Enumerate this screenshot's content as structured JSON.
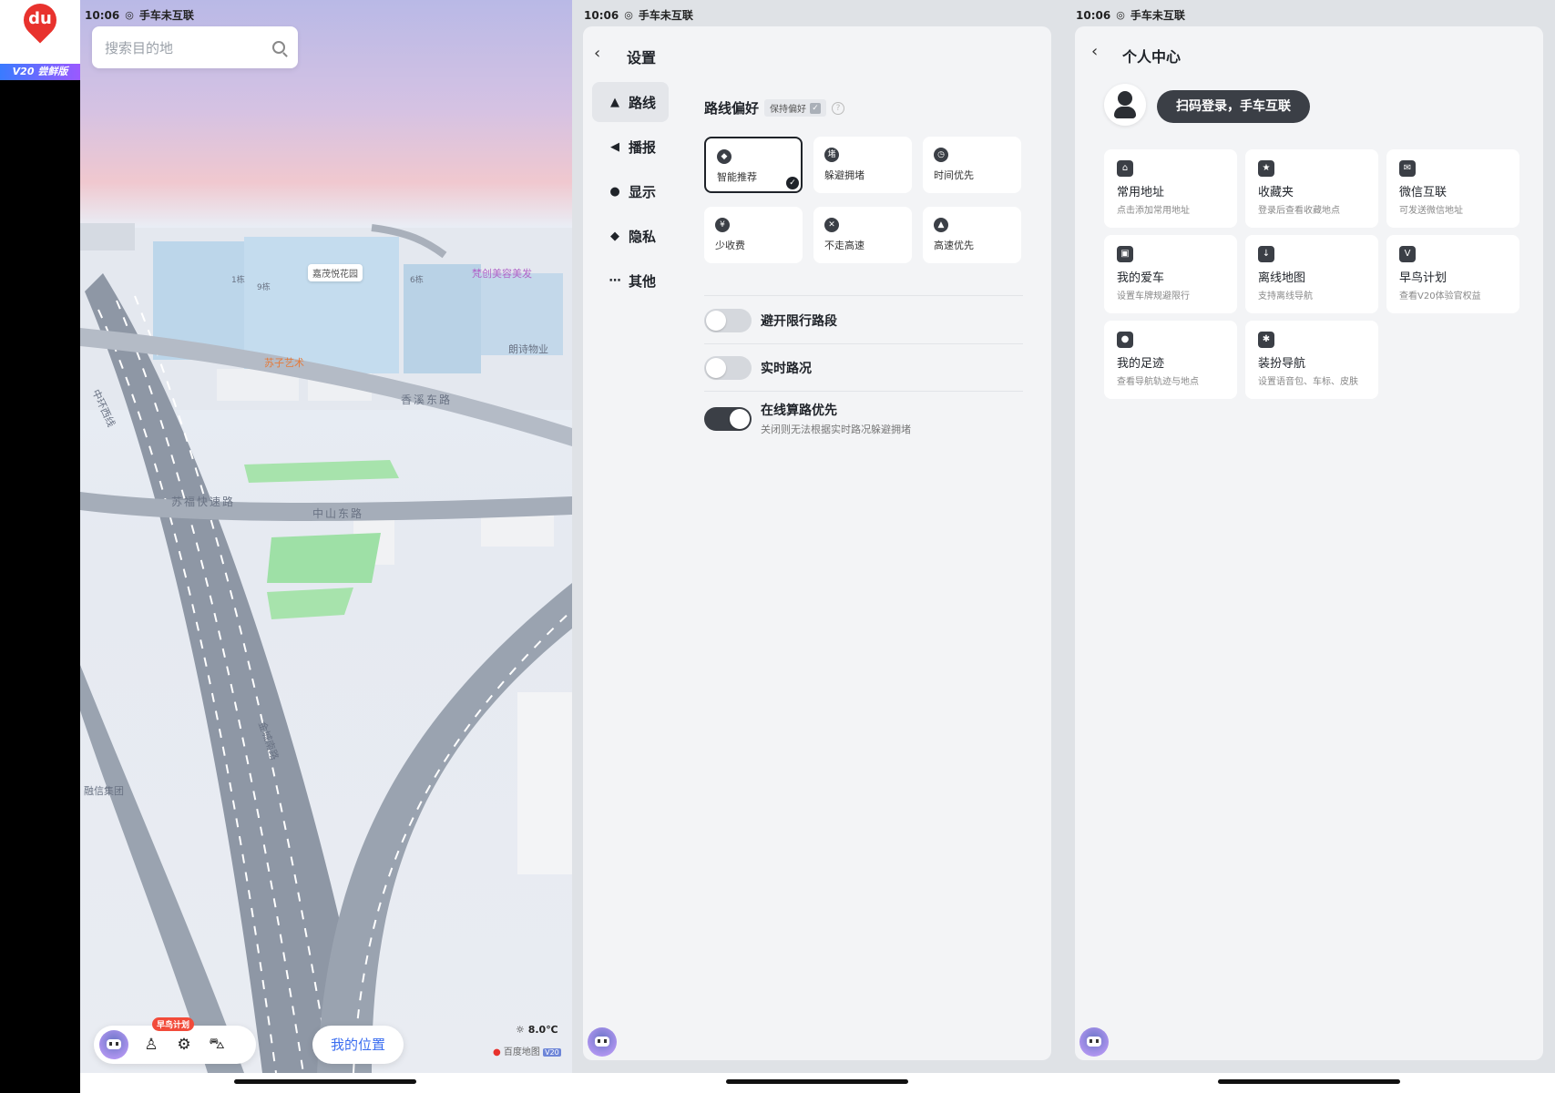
{
  "status": {
    "time": "10:06",
    "connection": "手车未互联"
  },
  "logo": {
    "brand": "du",
    "version": "V20 尝鲜版"
  },
  "map": {
    "search_placeholder": "搜索目的地",
    "labels": {
      "community": "嘉茂悦花园",
      "b1": "1栋",
      "b9": "9栋",
      "b6": "6栋",
      "beauty": "梵创美容美发",
      "art": "苏子艺术",
      "property": "朗诗物业",
      "road_xiangxi": "香溪东路",
      "road_zhonghuan": "中环西线",
      "road_sufu": "苏福快速路",
      "road_zhongshan": "中山东路",
      "road_jinshan": "金城南路",
      "group": "融信集团"
    },
    "badge": "早鸟计划",
    "my_location": "我的位置",
    "temperature": "8.0℃",
    "map_brand": "百度地图",
    "map_brand_ver": "V20"
  },
  "settings": {
    "title": "设置",
    "sidebar": [
      {
        "label": "路线",
        "icon": "navigation-arrow-icon"
      },
      {
        "label": "播报",
        "icon": "speaker-icon"
      },
      {
        "label": "显示",
        "icon": "location-pin-icon"
      },
      {
        "label": "隐私",
        "icon": "shield-icon"
      },
      {
        "label": "其他",
        "icon": "more-icon"
      }
    ],
    "route_pref_title": "路线偏好",
    "keep_pref": "保持偏好",
    "prefs": [
      {
        "label": "智能推荐",
        "glyph": "◆",
        "selected": true
      },
      {
        "label": "躲避拥堵",
        "glyph": "堵",
        "selected": false
      },
      {
        "label": "时间优先",
        "glyph": "◷",
        "selected": false
      },
      {
        "label": "少收费",
        "glyph": "¥",
        "selected": false
      },
      {
        "label": "不走高速",
        "glyph": "✕",
        "selected": false
      },
      {
        "label": "高速优先",
        "glyph": "▲",
        "selected": false
      }
    ],
    "toggles": [
      {
        "label": "避开限行路段",
        "sub": "",
        "on": false
      },
      {
        "label": "实时路况",
        "sub": "",
        "on": false
      },
      {
        "label": "在线算路优先",
        "sub": "关闭则无法根据实时路况躲避拥堵",
        "on": true
      }
    ]
  },
  "personal": {
    "title": "个人中心",
    "login": "扫码登录，手车互联",
    "cards": [
      {
        "title": "常用地址",
        "sub": "点击添加常用地址",
        "glyph": "⌂"
      },
      {
        "title": "收藏夹",
        "sub": "登录后查看收藏地点",
        "glyph": "★"
      },
      {
        "title": "微信互联",
        "sub": "可发送微信地址",
        "glyph": "✉"
      },
      {
        "title": "我的爱车",
        "sub": "设置车牌规避限行",
        "glyph": "▣"
      },
      {
        "title": "离线地图",
        "sub": "支持离线导航",
        "glyph": "↓"
      },
      {
        "title": "早鸟计划",
        "sub": "查看V20体验官权益",
        "glyph": "V"
      },
      {
        "title": "我的足迹",
        "sub": "查看导航轨迹与地点",
        "glyph": "●"
      },
      {
        "title": "装扮导航",
        "sub": "设置语音包、车标、皮肤",
        "glyph": "✱"
      }
    ]
  }
}
